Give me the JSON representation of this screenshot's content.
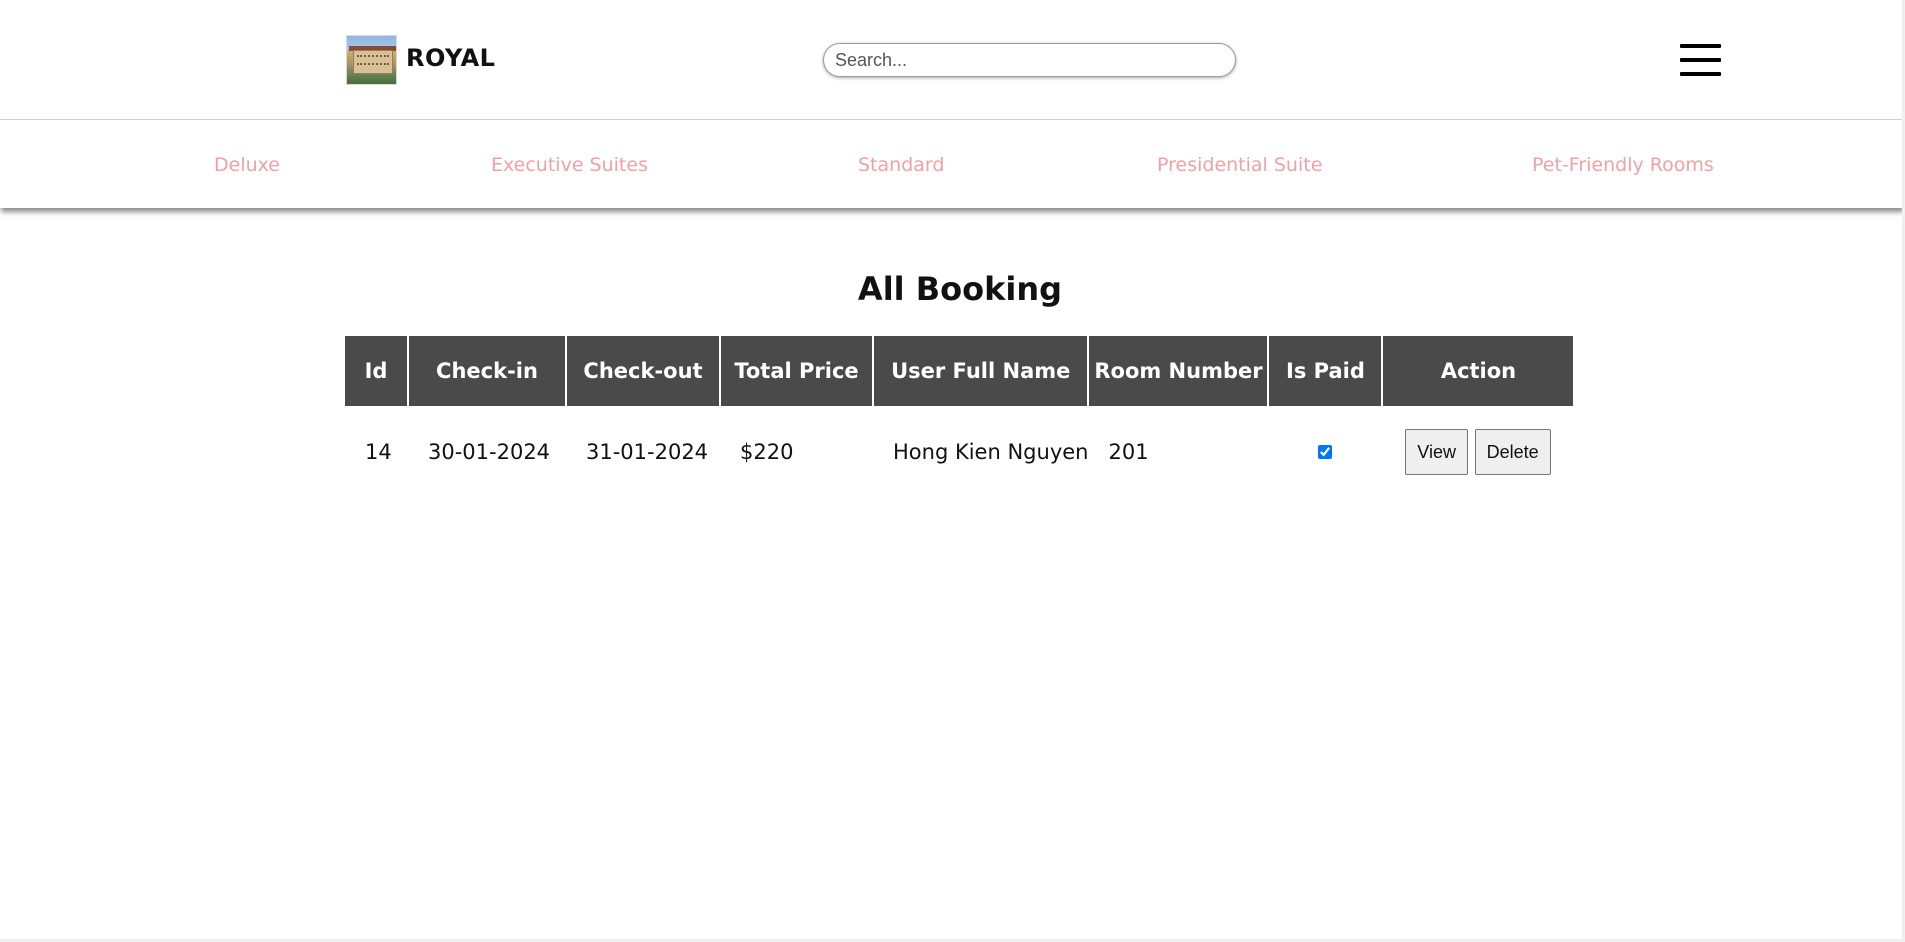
{
  "header": {
    "brand": "ROYAL",
    "search_placeholder": "Search..."
  },
  "nav": {
    "categories": [
      "Deluxe",
      "Executive Suites",
      "Standard",
      "Presidential Suite",
      "Pet-Friendly Rooms"
    ],
    "link_color": "#f2a0a6"
  },
  "page": {
    "title": "All Booking"
  },
  "table": {
    "header_bg": "#4b4a4a",
    "columns": [
      "Id",
      "Check-in",
      "Check-out",
      "Total Price",
      "User Full Name",
      "Room Number",
      "Is Paid",
      "Action"
    ],
    "rows": [
      {
        "id": "14",
        "check_in": "30-01-2024",
        "check_out": "31-01-2024",
        "total_price": "$220",
        "user_full_name": "Hong Kien Nguyen",
        "room_number": "201",
        "is_paid": true,
        "actions": {
          "view": "View",
          "delete": "Delete"
        }
      }
    ]
  }
}
